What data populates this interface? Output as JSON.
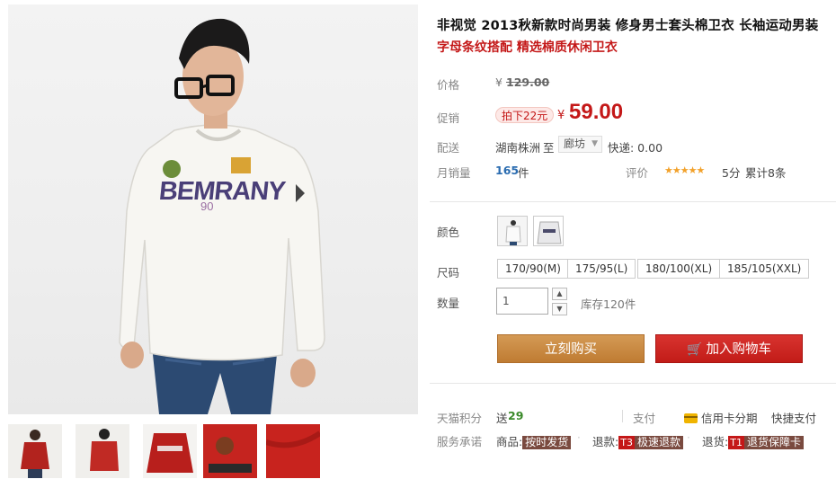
{
  "product": {
    "title": "非视觉 2013秋新款时尚男装 修身男士套头棉卫衣 长袖运动男装",
    "subtitle": "字母条纹搭配 精选棉质休闲卫衣"
  },
  "gallery": {
    "main_image": "model-wearing-white-sweatshirt",
    "shirt_print_text": "BEMRANY",
    "shirt_number_text": "90",
    "thumbnails": [
      "red-sweatshirt-front",
      "red-sweatshirt-back",
      "red-sweatshirt-flat",
      "red-fabric-detail",
      "red-fabric-closeup"
    ]
  },
  "pricing": {
    "price_label": "价格",
    "currency": "¥",
    "original_price": "129.00",
    "promo_label": "促销",
    "promo_badge": "拍下22元",
    "promo_price": "59.00"
  },
  "shipping": {
    "label": "配送",
    "origin": "湖南株洲",
    "to": "至",
    "destination": "廊坊",
    "express": "快递: 0.00"
  },
  "sales": {
    "monthly_label": "月销量",
    "monthly_value": "165",
    "monthly_unit": "件",
    "rating_label": "评价",
    "rating_stars": "★★★★★",
    "rating_score": "5分",
    "review_count": "累计8条"
  },
  "options": {
    "color_label": "颜色",
    "colors": [
      "white-sweatshirt",
      "grey-sweatshirt"
    ],
    "size_label": "尺码",
    "sizes": [
      "170/90(M)",
      "175/95(L)",
      "180/100(XL)",
      "185/105(XXL)"
    ],
    "qty_label": "数量",
    "qty_value": "1",
    "stock": "库存120件"
  },
  "actions": {
    "buy_now": "立刻购买",
    "add_to_cart": "加入购物车"
  },
  "services": {
    "points_label": "天猫积分",
    "points_prefix": "送",
    "points_value": "29",
    "pay_label": "支付",
    "installment": "信用卡分期",
    "quick_pay": "快捷支付",
    "promise_label": "服务承诺",
    "item_label": "商品:",
    "item_tag": "按时发货",
    "return_label": "退款:",
    "return_num": "T3",
    "return_tag": "极速退款",
    "goods_label": "退货:",
    "goods_num": "T1",
    "goods_tag": "退货保障卡"
  },
  "colors": {
    "accent_red": "#c41818",
    "buy_button": "#c5873e",
    "cart_button": "#c9221e",
    "star": "#f2a12a"
  }
}
